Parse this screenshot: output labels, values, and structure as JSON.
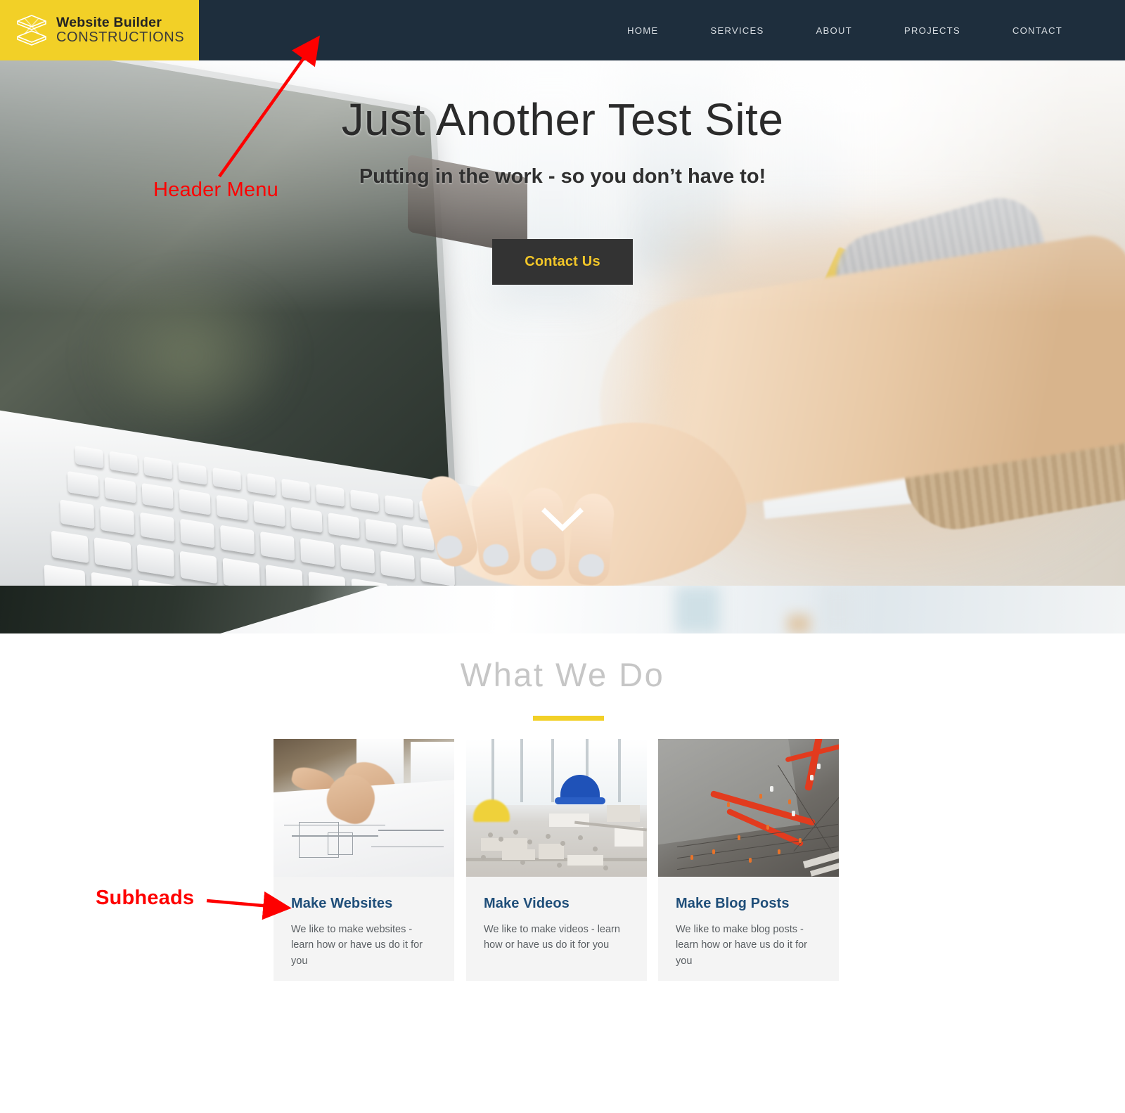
{
  "header": {
    "logo": {
      "icon": "stacked-layers-logo-icon",
      "line1": "Website Builder",
      "line2": "CONSTRUCTIONS",
      "bg_color": "#f2d027"
    },
    "bg_color": "#1e2e3d",
    "nav_items": [
      {
        "label": "HOME"
      },
      {
        "label": "SERVICES"
      },
      {
        "label": "ABOUT"
      },
      {
        "label": "PROJECTS"
      },
      {
        "label": "CONTACT"
      }
    ]
  },
  "hero": {
    "title": "Just Another Test Site",
    "subtitle": "Putting in the work - so you don’t have to!",
    "cta_label": "Contact Us",
    "cta_bg": "#333333",
    "cta_text_color": "#f2c628",
    "scroll_icon": "chevron-down-icon"
  },
  "services": {
    "title": "What We Do",
    "title_color": "#c6c6c6",
    "rule_color": "#f2d027",
    "cards": [
      {
        "image": "blueprint-review-photo",
        "title": "Make Websites",
        "text": "We like to make websites - learn how or have us do it for you"
      },
      {
        "image": "architecture-model-photo",
        "title": "Make Videos",
        "text": "We like to make videos - learn how or have us do it for you"
      },
      {
        "image": "construction-site-aerial-photo",
        "title": "Make Blog Posts",
        "text": "We like to make blog posts - learn how or have us do it for you"
      }
    ]
  },
  "annotations": {
    "color": "#fe0000",
    "items": [
      {
        "label": "Header Menu"
      },
      {
        "label": "Subheads"
      }
    ]
  }
}
